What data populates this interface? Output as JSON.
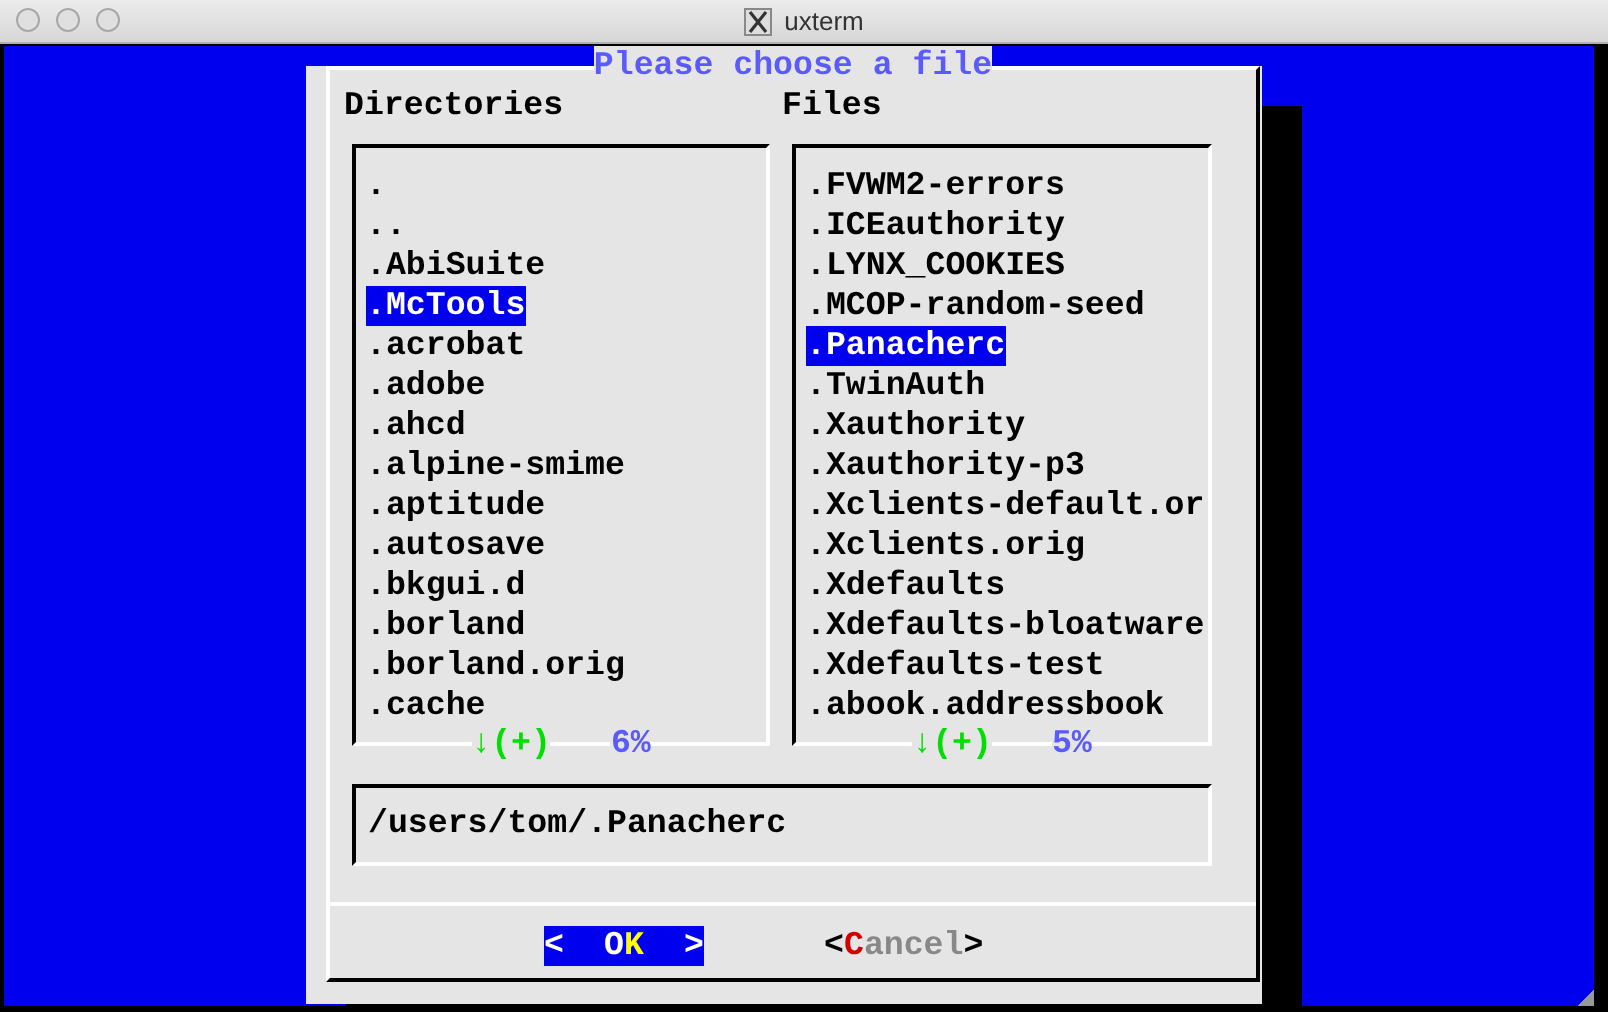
{
  "window": {
    "title": "uxterm"
  },
  "dialog": {
    "title": "Please choose a file",
    "directories": {
      "label": "Directories",
      "items": [
        {
          "name": ".",
          "selected": false
        },
        {
          "name": "..",
          "selected": false
        },
        {
          "name": ".AbiSuite",
          "selected": false
        },
        {
          "name": ".McTools",
          "selected": true
        },
        {
          "name": ".acrobat",
          "selected": false
        },
        {
          "name": ".adobe",
          "selected": false
        },
        {
          "name": ".ahcd",
          "selected": false
        },
        {
          "name": ".alpine-smime",
          "selected": false
        },
        {
          "name": ".aptitude",
          "selected": false
        },
        {
          "name": ".autosave",
          "selected": false
        },
        {
          "name": ".bkgui.d",
          "selected": false
        },
        {
          "name": ".borland",
          "selected": false
        },
        {
          "name": ".borland.orig",
          "selected": false
        },
        {
          "name": ".cache",
          "selected": false
        }
      ],
      "scroll_arrow": "↓(+)",
      "scroll_percent": "6%"
    },
    "files": {
      "label": "Files",
      "items": [
        {
          "name": ".FVWM2-errors",
          "selected": false
        },
        {
          "name": ".ICEauthority",
          "selected": false
        },
        {
          "name": ".LYNX_COOKIES",
          "selected": false
        },
        {
          "name": ".MCOP-random-seed",
          "selected": false
        },
        {
          "name": ".Panacherc",
          "selected": true
        },
        {
          "name": ".TwinAuth",
          "selected": false
        },
        {
          "name": ".Xauthority",
          "selected": false
        },
        {
          "name": ".Xauthority-p3",
          "selected": false
        },
        {
          "name": ".Xclients-default.or",
          "selected": false
        },
        {
          "name": ".Xclients.orig",
          "selected": false
        },
        {
          "name": ".Xdefaults",
          "selected": false
        },
        {
          "name": ".Xdefaults-bloatware",
          "selected": false
        },
        {
          "name": ".Xdefaults-test",
          "selected": false
        },
        {
          "name": ".abook.addressbook",
          "selected": false
        }
      ],
      "scroll_arrow": "↓(+)",
      "scroll_percent": "5%"
    },
    "path": "/users/tom/.Panacherc",
    "buttons": [
      {
        "left": "<",
        "before": "O",
        "hotkey": "K",
        "right": ">",
        "selected": true
      },
      {
        "left": "<",
        "hotkey": "C",
        "after": "ancel",
        "right": ">",
        "selected": false
      }
    ]
  }
}
